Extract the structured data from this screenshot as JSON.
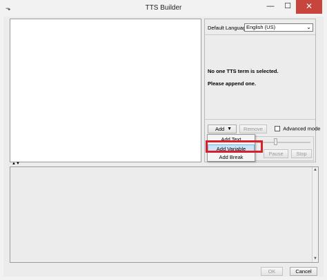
{
  "window": {
    "title": "TTS Builder",
    "minimize_glyph": "—",
    "maximize_glyph": "☐",
    "close_glyph": "✕",
    "app_icon": "app-icon"
  },
  "right_pane": {
    "default_language_label": "Default Language:",
    "language_value": "English (US)",
    "info_line_1": "No one TTS term is selected.",
    "info_line_2": "Please append one.",
    "add_label": "Add",
    "remove_label": "Remove",
    "advanced_mode_label": "Advanced mode",
    "advanced_mode_checked": false,
    "pause_label": "Pause",
    "stop_label": "Stop"
  },
  "add_menu": {
    "items": [
      {
        "label": "Add Text"
      },
      {
        "label": "Add Variable",
        "highlighted": true
      },
      {
        "label": "Add Break"
      }
    ]
  },
  "footer": {
    "ok_label": "OK",
    "cancel_label": "Cancel"
  },
  "colors": {
    "annotation_red": "#d8202a",
    "menu_highlight": "#cce4f7",
    "close_button": "#c7453c"
  }
}
